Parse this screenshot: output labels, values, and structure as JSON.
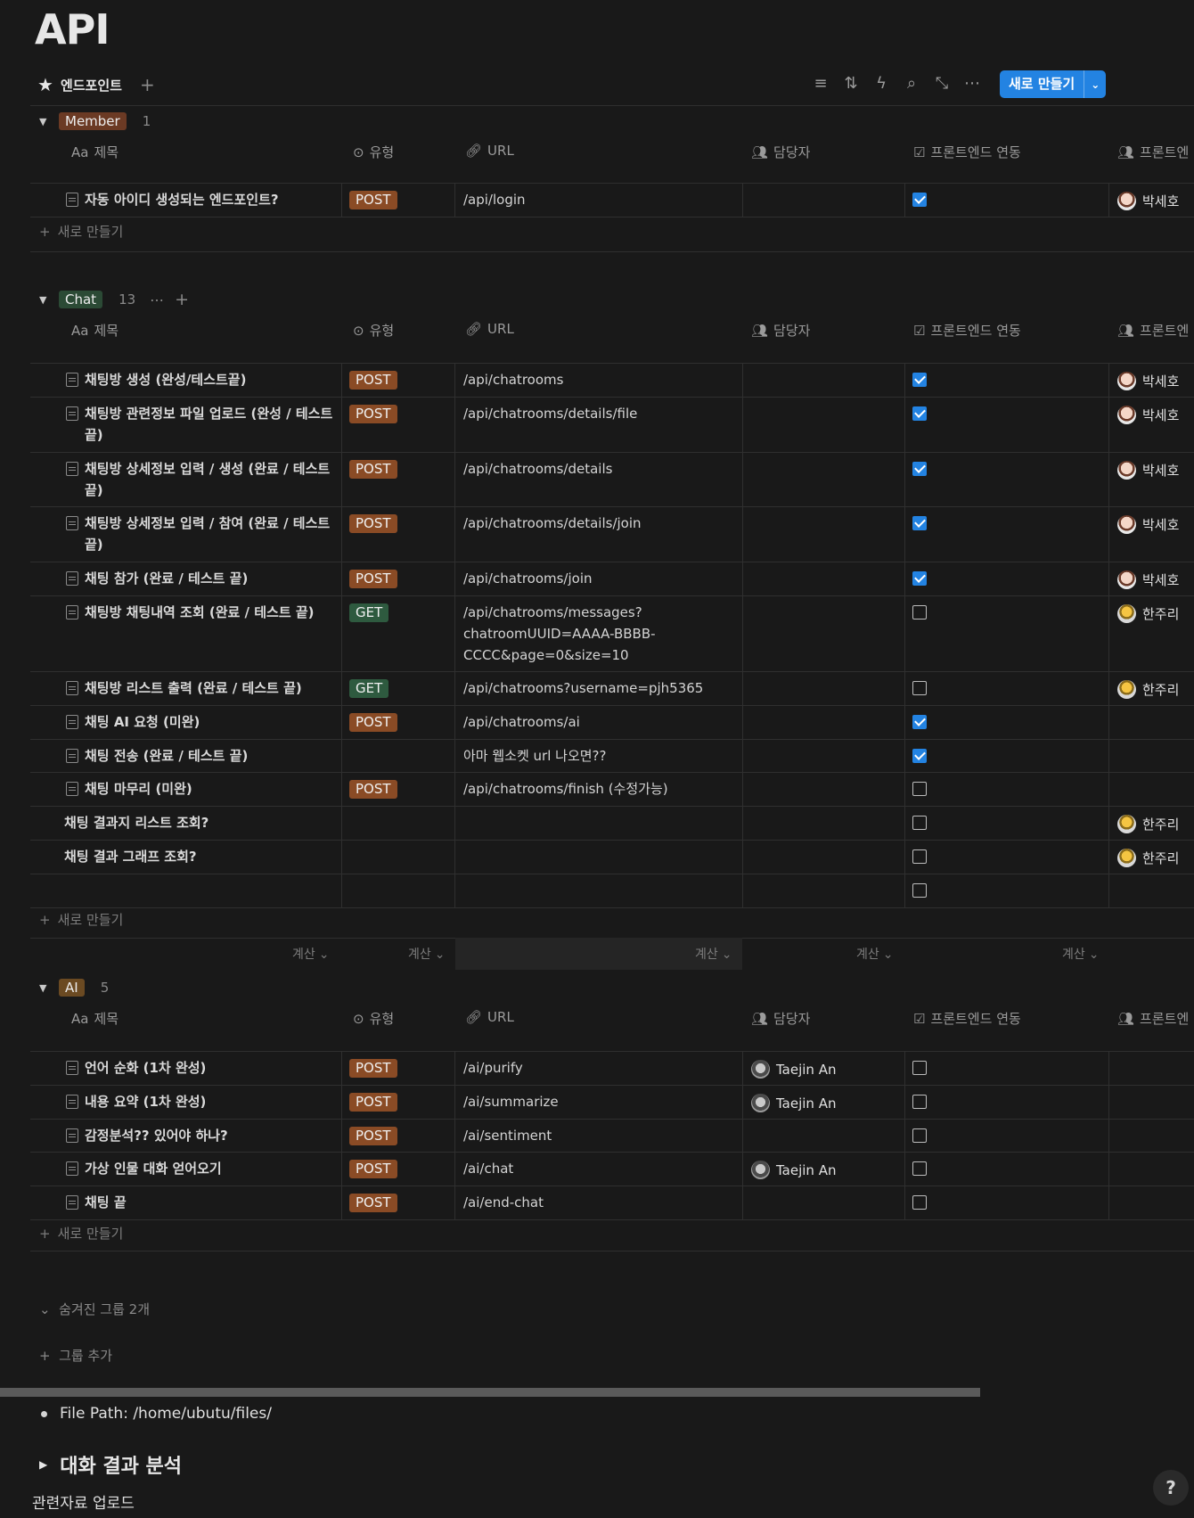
{
  "page": {
    "title": "API"
  },
  "view": {
    "tab_label": "엔드포인트",
    "new_button": "새로 만들기"
  },
  "columns": {
    "title": "제목",
    "title_prefix": "Aa",
    "type": "유형",
    "url": "URL",
    "assignee": "담당자",
    "frontend": "프론트엔드 연동",
    "frontend_person": "프론트엔"
  },
  "common": {
    "add_row": "새로 만들기",
    "calc": "계산"
  },
  "groups": {
    "member": {
      "label": "Member",
      "count": "1",
      "color": "#6b3a24",
      "rows": [
        {
          "name": "자동 아이디 생성되는 엔드포인트?",
          "method": "POST",
          "url": "/api/login",
          "assignee": "",
          "checked": true,
          "fe": "박세호"
        }
      ]
    },
    "chat": {
      "label": "Chat",
      "count": "13",
      "color": "#2b4a35",
      "rows": [
        {
          "name": "채팅방 생성 (완성/테스트끝)",
          "method": "POST",
          "url": "/api/chatrooms",
          "checked": true,
          "fe": "박세호"
        },
        {
          "name": "채팅방 관련정보 파일 업로드 (완성 / 테스트 끝)",
          "method": "POST",
          "url": "/api/chatrooms/details/file",
          "checked": true,
          "fe": "박세호"
        },
        {
          "name": "채팅방 상세정보 입력 / 생성 (완료 / 테스트 끝)",
          "method": "POST",
          "url": "/api/chatrooms/details",
          "checked": true,
          "fe": "박세호"
        },
        {
          "name": "채팅방 상세정보 입력 / 참여 (완료 / 테스트 끝)",
          "method": "POST",
          "url": "/api/chatrooms/details/join",
          "checked": true,
          "fe": "박세호"
        },
        {
          "name": "채팅 참가 (완료 / 테스트 끝)",
          "method": "POST",
          "url": "/api/chatrooms/join",
          "checked": true,
          "fe": "박세호"
        },
        {
          "name": "채팅방 채팅내역 조회 (완료 / 테스트 끝)",
          "method": "GET",
          "url": "/api/chatrooms/messages?chatroomUUID=AAAA-BBBB-CCCC&page=0&size=10",
          "url_lines": [
            "/api/chatrooms/messages?",
            "chatroomUUID=AAAA-BBBB-",
            "CCCC&page=0&size=10"
          ],
          "checked": false,
          "fe": "한주리"
        },
        {
          "name": "채팅방 리스트 출력 (완료 / 테스트 끝)",
          "method": "GET",
          "url": "/api/chatrooms?username=pjh5365",
          "checked": false,
          "fe": "한주리"
        },
        {
          "name": "채팅 AI 요청 (미완)",
          "method": "POST",
          "url": "/api/chatrooms/ai",
          "checked": true,
          "fe": ""
        },
        {
          "name": "채팅 전송 (완료 / 테스트 끝)",
          "method": "",
          "url": "아마 웹소켓 url 나오면??",
          "checked": true,
          "fe": ""
        },
        {
          "name": "채팅 마무리 (미완)",
          "method": "POST",
          "url": "/api/chatrooms/finish (수정가능)",
          "checked": false,
          "fe": ""
        },
        {
          "name": "채팅 결과지 리스트 조회?",
          "method": "",
          "url": "",
          "checked": false,
          "fe": "한주리"
        },
        {
          "name": "채팅 결과 그래프 조회?",
          "method": "",
          "url": "",
          "checked": false,
          "fe": "한주리"
        },
        {
          "name": "",
          "method": "",
          "url": "",
          "checked": false,
          "fe": ""
        }
      ]
    },
    "ai": {
      "label": "AI",
      "count": "5",
      "color": "#6b4a22",
      "rows": [
        {
          "name": "언어 순화 (1차 완성)",
          "method": "POST",
          "url": "/ai/purify",
          "assignee": "Taejin An",
          "checked": false
        },
        {
          "name": "내용 요약 (1차 완성)",
          "method": "POST",
          "url": "/ai/summarize",
          "assignee": "Taejin An",
          "checked": false
        },
        {
          "name": "감정분석?? 있어야 하나?",
          "method": "POST",
          "url": "/ai/sentiment",
          "assignee": "",
          "checked": false
        },
        {
          "name": "가상 인물 대화 얻어오기",
          "method": "POST",
          "url": "/ai/chat",
          "assignee": "Taejin An",
          "checked": false
        },
        {
          "name": "채팅 끝",
          "method": "POST",
          "url": "/ai/end-chat",
          "assignee": "",
          "checked": false
        }
      ]
    }
  },
  "footer": {
    "hidden_groups": "숨겨진 그룹 2개",
    "add_group": "그룹 추가",
    "file_path": "File Path: /home/ubutu/files/",
    "toggle_heading": "대화 결과 분석",
    "related": "관련자료 업로드",
    "help": "?"
  }
}
